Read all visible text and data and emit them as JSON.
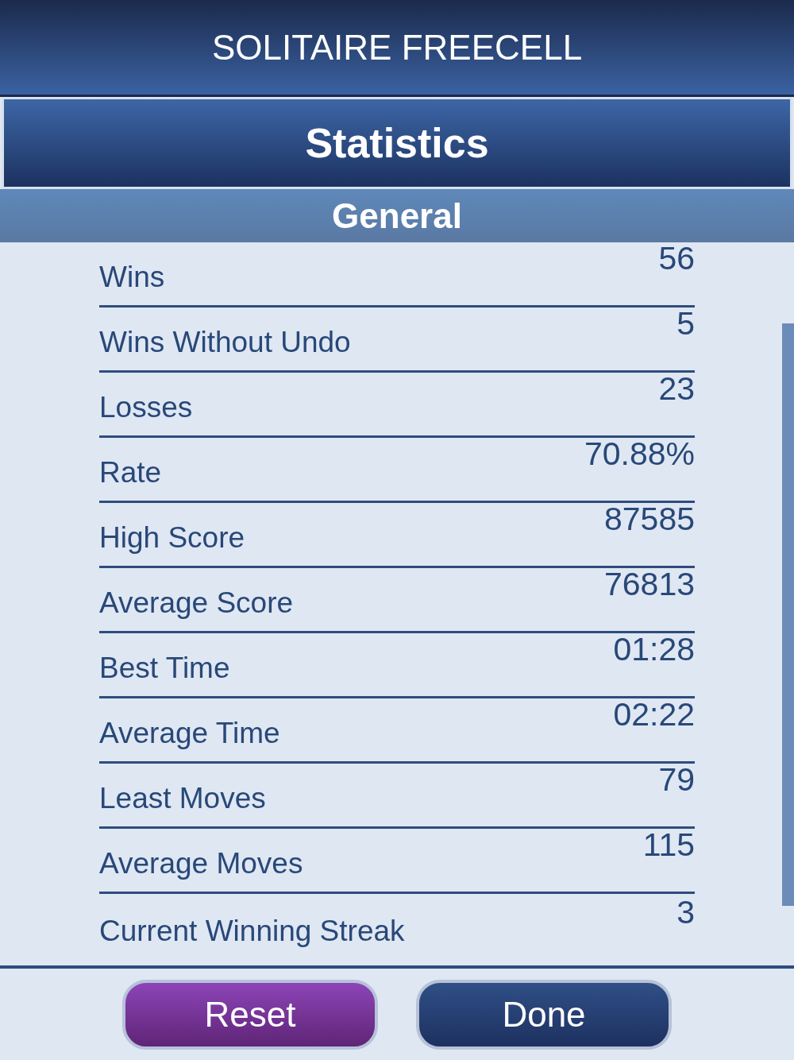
{
  "header": {
    "title": "SOLITAIRE FREECELL"
  },
  "page_title": "Statistics",
  "section": "General",
  "stats": [
    {
      "label": "Wins",
      "value": "56"
    },
    {
      "label": "Wins Without Undo",
      "value": "5"
    },
    {
      "label": "Losses",
      "value": "23"
    },
    {
      "label": "Rate",
      "value": "70.88%"
    },
    {
      "label": "High Score",
      "value": "87585"
    },
    {
      "label": "Average Score",
      "value": "76813"
    },
    {
      "label": "Best Time",
      "value": "01:28"
    },
    {
      "label": "Average Time",
      "value": "02:22"
    },
    {
      "label": "Least Moves",
      "value": "79"
    },
    {
      "label": "Average Moves",
      "value": "115"
    },
    {
      "label": "Current Winning Streak",
      "value": "3"
    }
  ],
  "buttons": [
    {
      "label": "Reset",
      "kind": "reset"
    },
    {
      "label": "Done",
      "kind": "done"
    }
  ]
}
